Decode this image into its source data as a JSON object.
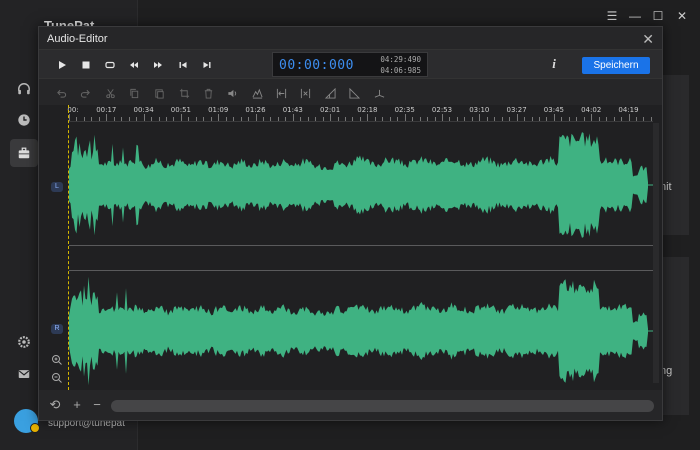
{
  "app": {
    "logo": "TunePat",
    "support_text": "support@tunepat",
    "card1_text": "nit",
    "card2_text": "ng"
  },
  "dialog": {
    "title": "Audio-Editor",
    "time": {
      "current": "00:00:000",
      "total_a": "04:29:490",
      "total_b": "04:06:985"
    },
    "info_label": "i",
    "save_label": "Speichern"
  },
  "ruler": {
    "ticks": [
      "00:",
      "00:17",
      "00:34",
      "00:51",
      "01:09",
      "01:26",
      "01:43",
      "02:01",
      "02:18",
      "02:35",
      "02:53",
      "03:10",
      "03:27",
      "03:45",
      "04:02",
      "04:19"
    ]
  },
  "channels": {
    "left_label": "L",
    "right_label": "R"
  },
  "colors": {
    "waveform": "#3fb282",
    "accent": "#1a73e8",
    "time_text": "#3d8ef0",
    "playhead": "#d6b800"
  },
  "icons": {
    "toolbar": [
      "play-icon",
      "stop-icon",
      "loop-icon",
      "rewind-icon",
      "fast-forward-icon",
      "skip-back-icon",
      "skip-forward-icon"
    ],
    "editbar": [
      "undo-icon",
      "redo-icon",
      "cut-icon",
      "copy-icon",
      "paste-icon",
      "crop-icon",
      "delete-icon",
      "volume-icon",
      "amplify-icon",
      "trim-icon",
      "silence-icon",
      "fade-in-icon",
      "fade-out-icon",
      "pitch-icon"
    ]
  }
}
